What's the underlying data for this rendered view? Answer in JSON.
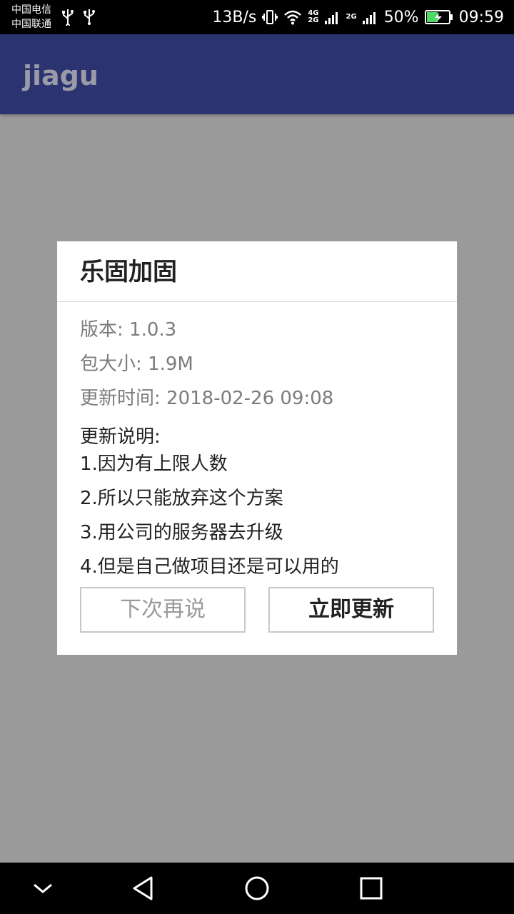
{
  "status_bar": {
    "carrier_1": "中国电信",
    "carrier_2": "中国联通",
    "speed": "13B/s",
    "net_4g": "4G",
    "net_2g_top": "2G",
    "net_2g": "2G",
    "battery": "50%",
    "time": "09:59",
    "battery_color": "#4cd964"
  },
  "app_bar": {
    "title": "jiagu",
    "color": "#2b3470"
  },
  "dialog": {
    "title": "乐固加固",
    "version": "版本: 1.0.3",
    "size": "包大小: 1.9M",
    "update_time": "更新时间: 2018-02-26 09:08",
    "notes_heading": "更新说明:",
    "notes": [
      "1.因为有上限人数",
      "2.所以只能放弃这个方案",
      "3.用公司的服务器去升级",
      "4.但是自己做项目还是可以用的"
    ],
    "later_label": "下次再说",
    "update_label": "立即更新"
  },
  "icons": {
    "usb": "usb-icon",
    "vibrate": "vibrate-icon",
    "wifi": "wifi-icon",
    "signal": "signal-icon",
    "battery": "battery-charging-icon",
    "nav_down": "chevron-down-icon",
    "nav_back": "back-triangle-icon",
    "nav_home": "home-circle-icon",
    "nav_recents": "recents-square-icon"
  }
}
